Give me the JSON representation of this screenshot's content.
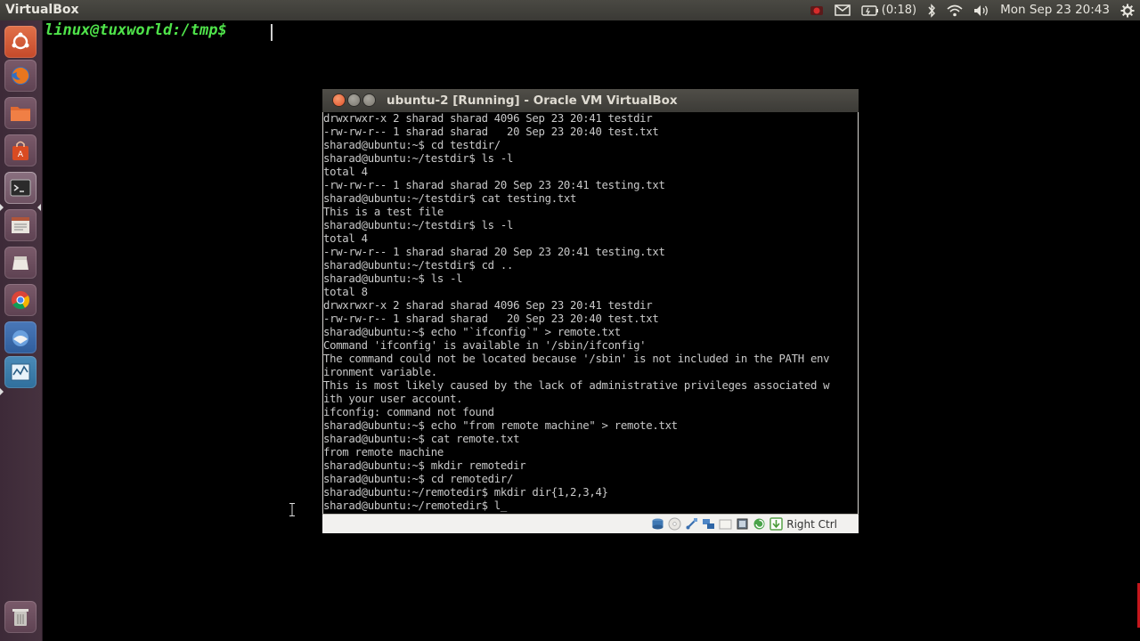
{
  "top_panel": {
    "app_title": "VirtualBox",
    "battery_time": "(0:18)",
    "datetime": "Mon Sep 23 20:43",
    "icons": [
      "record-icon",
      "mail-icon",
      "battery-icon",
      "bluetooth-icon",
      "wifi-icon",
      "volume-icon",
      "gear-icon"
    ]
  },
  "launcher": {
    "items": [
      "ubuntu-dash",
      "firefox",
      "files",
      "software-center",
      "terminal",
      "text-editor",
      "ubuntu-one",
      "chrome",
      "thunderbird",
      "system-monitor",
      "trash"
    ]
  },
  "host_terminal": {
    "prompt": "linux@tuxworld:/tmp$"
  },
  "vbox_window": {
    "title": "ubuntu-2 [Running] - Oracle VM VirtualBox",
    "console_lines": [
      "drwxrwxr-x 2 sharad sharad 4096 Sep 23 20:41 testdir",
      "-rw-rw-r-- 1 sharad sharad   20 Sep 23 20:40 test.txt",
      "sharad@ubuntu:~$ cd testdir/",
      "sharad@ubuntu:~/testdir$ ls -l",
      "total 4",
      "-rw-rw-r-- 1 sharad sharad 20 Sep 23 20:41 testing.txt",
      "sharad@ubuntu:~/testdir$ cat testing.txt",
      "This is a test file",
      "sharad@ubuntu:~/testdir$ ls -l",
      "total 4",
      "-rw-rw-r-- 1 sharad sharad 20 Sep 23 20:41 testing.txt",
      "sharad@ubuntu:~/testdir$ cd ..",
      "sharad@ubuntu:~$ ls -l",
      "total 8",
      "drwxrwxr-x 2 sharad sharad 4096 Sep 23 20:41 testdir",
      "-rw-rw-r-- 1 sharad sharad   20 Sep 23 20:40 test.txt",
      "sharad@ubuntu:~$ echo \"`ifconfig`\" > remote.txt",
      "Command 'ifconfig' is available in '/sbin/ifconfig'",
      "The command could not be located because '/sbin' is not included in the PATH env",
      "ironment variable.",
      "This is most likely caused by the lack of administrative privileges associated w",
      "ith your user account.",
      "ifconfig: command not found",
      "sharad@ubuntu:~$ echo \"from remote machine\" > remote.txt",
      "sharad@ubuntu:~$ cat remote.txt",
      "from remote machine",
      "sharad@ubuntu:~$ mkdir remotedir",
      "sharad@ubuntu:~$ cd remotedir/",
      "sharad@ubuntu:~/remotedir$ mkdir dir{1,2,3,4}",
      "sharad@ubuntu:~/remotedir$ l_"
    ],
    "host_key_label": "Right Ctrl",
    "status_icons": [
      "hard-disk-icon",
      "optical-drive-icon",
      "usb-icon",
      "network-icon",
      "shared-folder-icon",
      "display-icon",
      "video-capture-icon",
      "mouse-integration-icon"
    ]
  },
  "colors": {
    "host_prompt": "#4fe34a",
    "console_text": "#c9c9c9",
    "panel_bg": "#3c3b37",
    "close_button": "#e0512a"
  }
}
